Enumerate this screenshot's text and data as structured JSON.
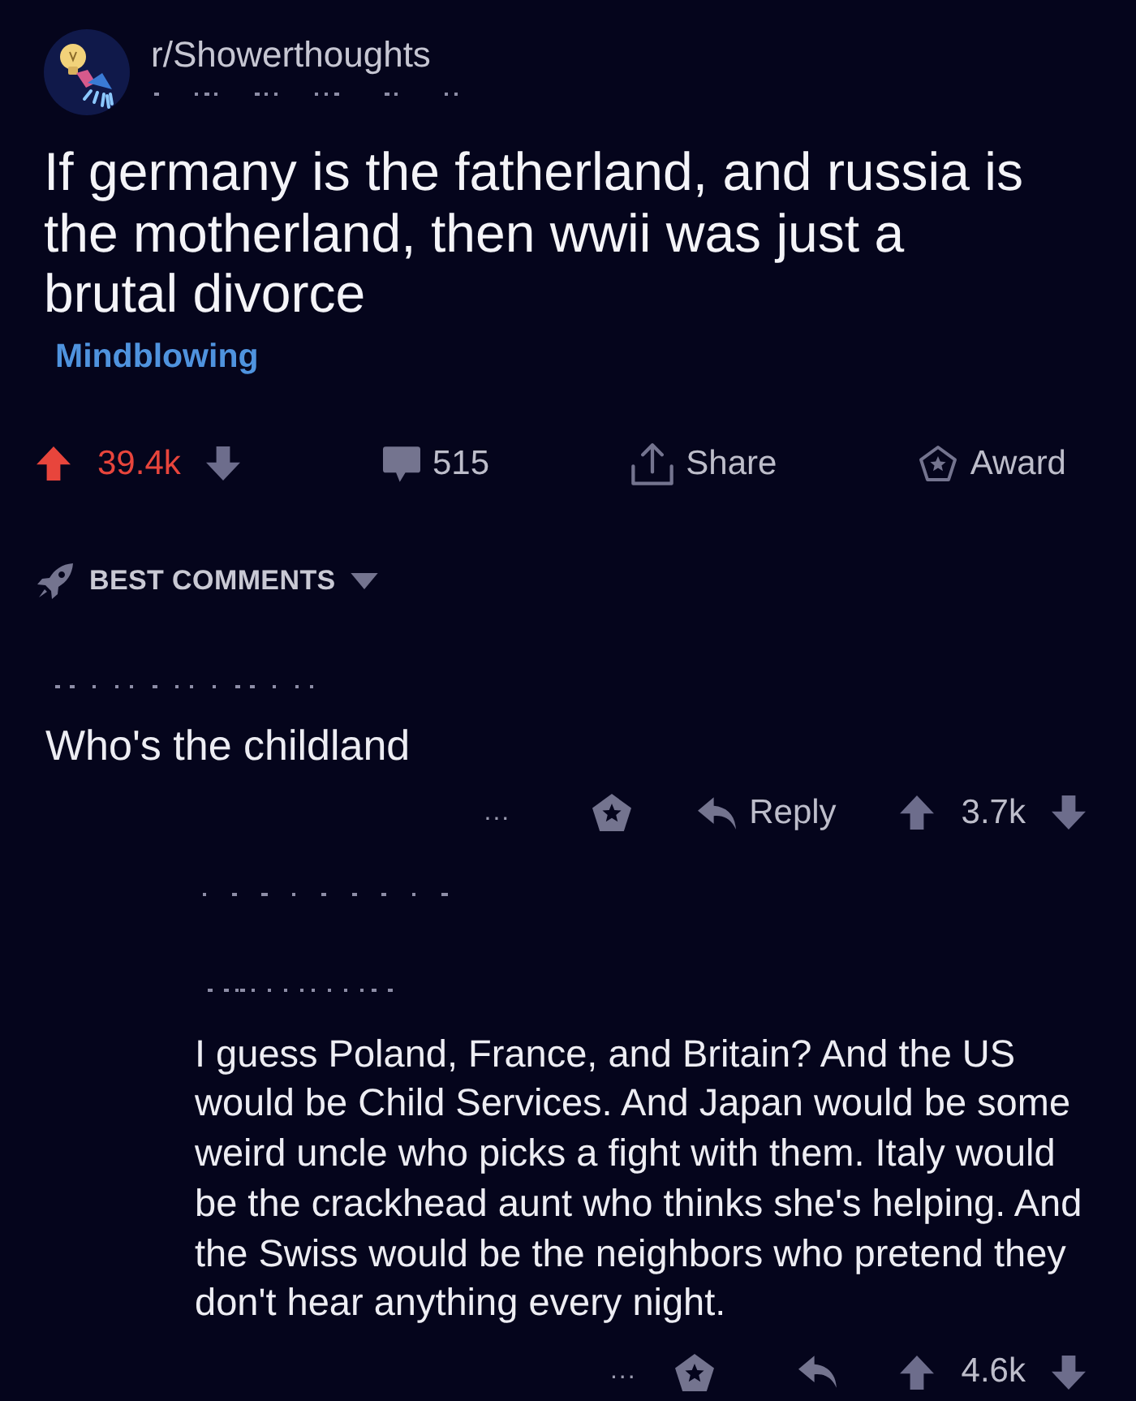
{
  "post": {
    "subreddit": "r/Showerthoughts",
    "title": "If germany is the fatherland, and russia is the motherland, then wwii was just a brutal divorce",
    "flair": "Mindblowing",
    "upvoted": true,
    "score": "39.4k",
    "comment_count": "515",
    "share": "Share",
    "award": "Award"
  },
  "sort": {
    "label": "BEST COMMENTS"
  },
  "comments": [
    {
      "text": "Who's the childland",
      "more": "...",
      "reply": "Reply",
      "score": "3.7k",
      "upvoted": false,
      "children": [
        {
          "text": "I guess Poland, France, and Britain? And the US would be Child Services. And Japan would be some weird uncle who picks a fight with them. Italy would be the crackhead aunt who thinks she's helping. And the Swiss would be the neighbors who pretend they don't hear anything every night.",
          "more": "...",
          "score": "4.6k",
          "upvoted": false
        }
      ]
    }
  ]
}
